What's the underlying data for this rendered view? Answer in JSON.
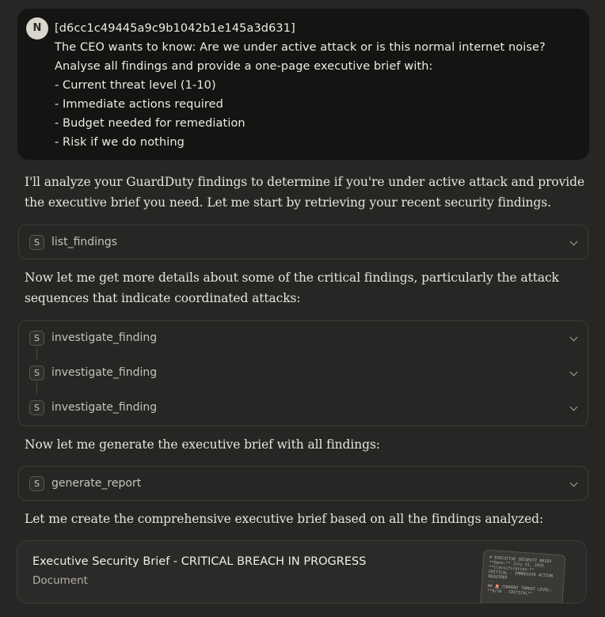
{
  "user_message": {
    "avatar_initial": "N",
    "lines": [
      "[d6cc1c49445a9c9b1042b1e145a3d631]",
      "The CEO wants to know: Are we under active attack or is this normal internet noise?",
      "Analyse all findings and provide a one-page executive brief with:",
      "- Current threat level (1-10)",
      "- Immediate actions required",
      "- Budget needed for remediation",
      "- Risk if we do nothing"
    ]
  },
  "assistant": {
    "intro_lines": [
      "I'll analyze your GuardDuty findings to determine if you're under active attack and provide",
      "the executive brief you need. Let me start by retrieving your recent security findings."
    ],
    "details_lines": [
      "Now let me get more details about some of the critical findings, particularly the attack",
      "sequences that indicate coordinated attacks:"
    ],
    "generate_line": "Now let me generate the executive brief with all findings:",
    "create_line": "Let me create the comprehensive executive brief based on all the findings analyzed:"
  },
  "tools": {
    "badge": "S",
    "list": "list_findings",
    "investigate": [
      "investigate_finding",
      "investigate_finding",
      "investigate_finding"
    ],
    "generate": "generate_report"
  },
  "document": {
    "title": "Executive Security Brief - CRITICAL BREACH IN PROGRESS",
    "type": "Document",
    "thumbnail_lines": [
      "# EXECUTIVE SECURITY BRIEF",
      "**Date:** July 31, 2025",
      "**Classification:**",
      "CRITICAL - IMMEDIATE ACTION",
      "REQUIRED",
      "---",
      "",
      "## 🚨 CURRENT THREAT LEVEL:",
      "**9/10 - CRITICAL**"
    ]
  }
}
